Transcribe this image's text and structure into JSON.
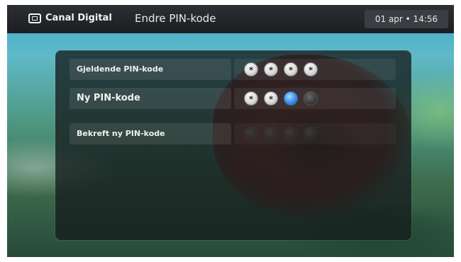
{
  "header": {
    "brand": "Canal Digital",
    "title": "Endre PIN-kode",
    "datetime": "01 apr • 14:56"
  },
  "form": {
    "rows": [
      {
        "label": "Gjeldende PIN-kode",
        "digits": [
          "*",
          "*",
          "*",
          "*"
        ],
        "state": [
          "filled",
          "filled",
          "filled",
          "filled"
        ]
      },
      {
        "label": "Ny PIN-kode",
        "digits": [
          "*",
          "*",
          "",
          ""
        ],
        "state": [
          "filled",
          "filled",
          "current",
          "empty"
        ]
      },
      {
        "label": "Bekreft ny PIN-kode",
        "digits": [
          "",
          "",
          "",
          ""
        ],
        "state": [
          "disabled",
          "disabled",
          "disabled",
          "disabled"
        ]
      }
    ]
  },
  "colors": {
    "accent": "#3d8ee6",
    "topbar": "#1c1e21"
  }
}
